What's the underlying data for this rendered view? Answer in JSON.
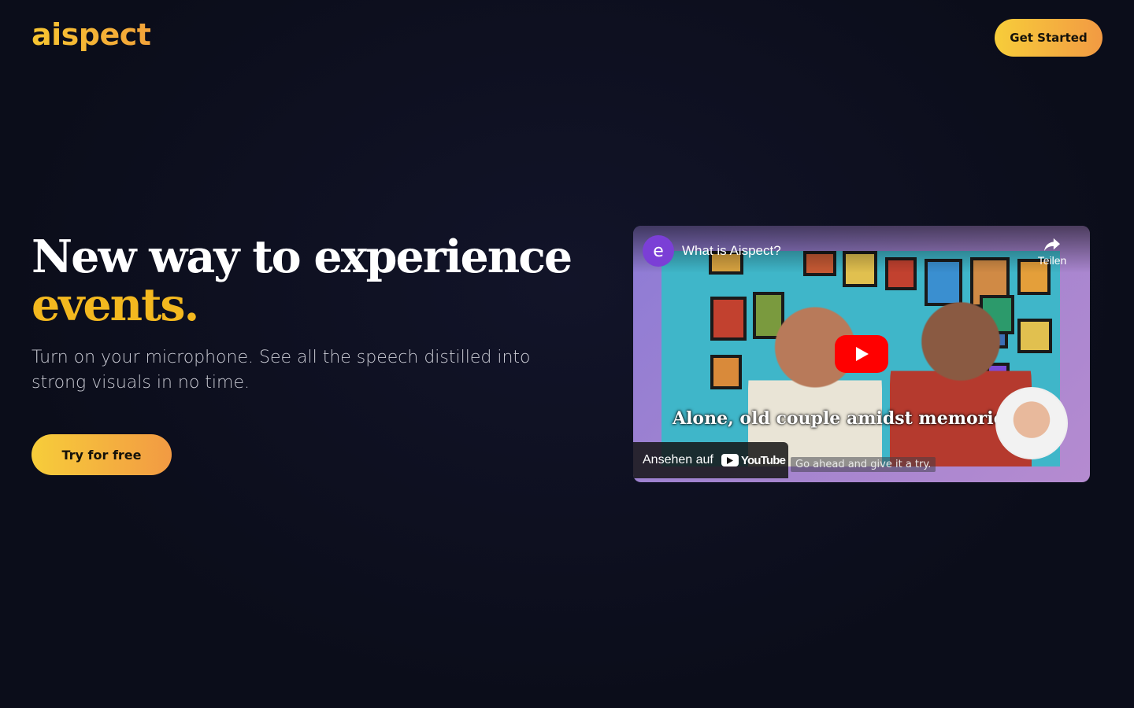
{
  "brand": {
    "logo_text": "aispect"
  },
  "header": {
    "cta_label": "Get Started"
  },
  "hero": {
    "title_line1": "New way to experience",
    "title_accent": "events.",
    "subtitle": "Turn on your microphone. See all the speech distilled into strong visuals in no time.",
    "cta_label": "Try for free"
  },
  "video": {
    "title": "What is Aispect?",
    "channel_initial": "e",
    "share_label": "Teilen",
    "art_caption": "Alone, old couple amidst memories.",
    "subtitle_text": "Go ahead and give it a try.",
    "watch_on_label": "Ansehen auf",
    "platform_label": "YouTube"
  },
  "colors": {
    "accent": "#f3b81f",
    "button_gradient_start": "#f7cd3a",
    "button_gradient_end": "#f29a43",
    "background": "#0c0e1c",
    "play_button": "#ff0000"
  },
  "icons": {
    "share": "share-arrow-icon",
    "play": "play-icon",
    "youtube": "youtube-logo-icon"
  }
}
